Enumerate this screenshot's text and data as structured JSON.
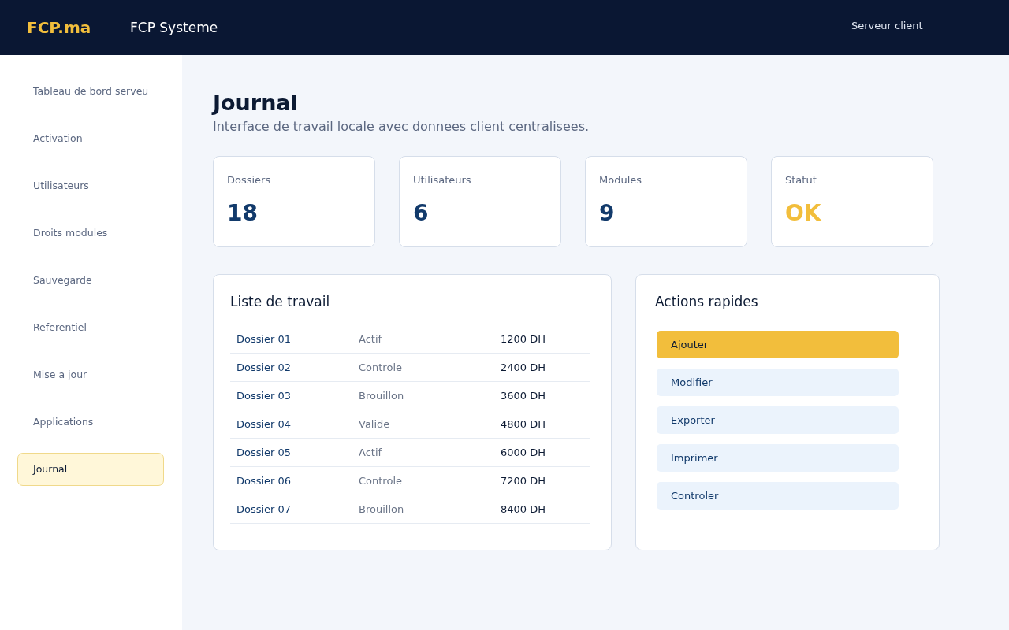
{
  "header": {
    "logo": "FCP.ma",
    "app_title": "FCP Systeme",
    "server_label": "Serveur client"
  },
  "sidebar": {
    "items": [
      {
        "label": "Tableau de bord serveu",
        "selected": false
      },
      {
        "label": "Activation",
        "selected": false
      },
      {
        "label": "Utilisateurs",
        "selected": false
      },
      {
        "label": "Droits modules",
        "selected": false
      },
      {
        "label": "Sauvegarde",
        "selected": false
      },
      {
        "label": "Referentiel",
        "selected": false
      },
      {
        "label": "Mise a jour",
        "selected": false
      },
      {
        "label": "Applications",
        "selected": false
      },
      {
        "label": "Journal",
        "selected": true
      }
    ]
  },
  "page": {
    "title": "Journal",
    "subtitle": "Interface de travail locale avec donnees client centralisees."
  },
  "stats": [
    {
      "label": "Dossiers",
      "value": "18",
      "kind": "count"
    },
    {
      "label": "Utilisateurs",
      "value": "6",
      "kind": "count"
    },
    {
      "label": "Modules",
      "value": "9",
      "kind": "count"
    },
    {
      "label": "Statut",
      "value": "OK",
      "kind": "status"
    }
  ],
  "work_list": {
    "title": "Liste de travail",
    "rows": [
      {
        "name": "Dossier 01",
        "status": "Actif",
        "amount": "1200 DH"
      },
      {
        "name": "Dossier 02",
        "status": "Controle",
        "amount": "2400 DH"
      },
      {
        "name": "Dossier 03",
        "status": "Brouillon",
        "amount": "3600 DH"
      },
      {
        "name": "Dossier 04",
        "status": "Valide",
        "amount": "4800 DH"
      },
      {
        "name": "Dossier 05",
        "status": "Actif",
        "amount": "6000 DH"
      },
      {
        "name": "Dossier 06",
        "status": "Controle",
        "amount": "7200 DH"
      },
      {
        "name": "Dossier 07",
        "status": "Brouillon",
        "amount": "8400 DH"
      }
    ]
  },
  "quick_actions": {
    "title": "Actions rapides",
    "buttons": [
      {
        "label": "Ajouter",
        "selected": true
      },
      {
        "label": "Modifier",
        "selected": false
      },
      {
        "label": "Exporter",
        "selected": false
      },
      {
        "label": "Imprimer",
        "selected": false
      },
      {
        "label": "Controler",
        "selected": false
      }
    ]
  }
}
